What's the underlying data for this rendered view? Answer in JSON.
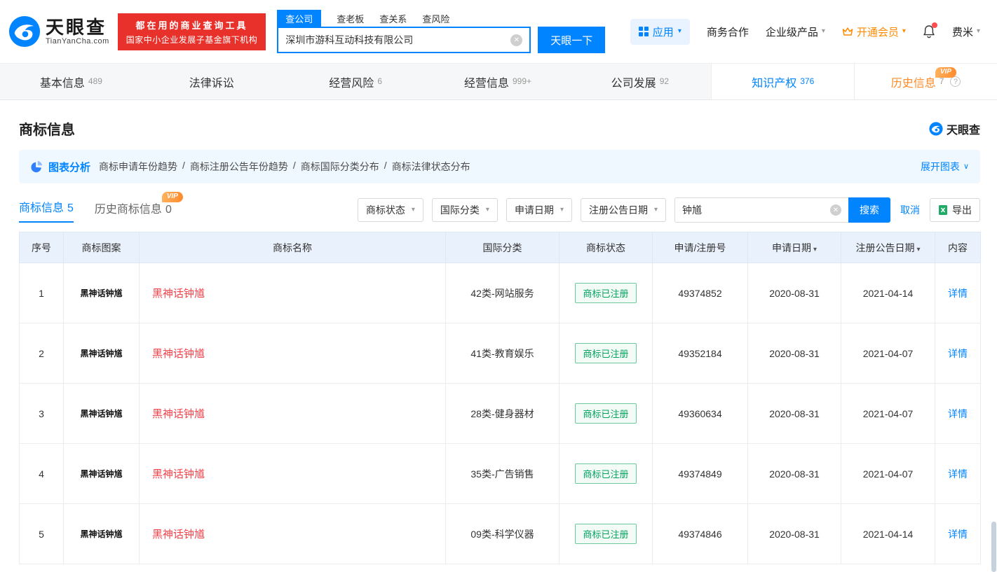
{
  "colors": {
    "brand_blue": "#0084ff",
    "slogan_red": "#e9312b",
    "vip_orange": "#ff8a00",
    "history_orange": "#ff8a26",
    "status_green": "#00a35c",
    "name_red": "#f2434b"
  },
  "icons": {
    "caret_down": "▾",
    "clear": "✕",
    "help": "?",
    "expand_caret": "∨"
  },
  "badges": {
    "vip": "VIP"
  },
  "header": {
    "logo": {
      "brand": "天眼查",
      "domain": "TianYanCha.com"
    },
    "slogan": {
      "line1": "都在用的商业查询工具",
      "line2": "国家中小企业发展子基金旗下机构"
    },
    "search_tabs": [
      {
        "label": "查公司"
      },
      {
        "label": "查老板"
      },
      {
        "label": "查关系"
      },
      {
        "label": "查风险"
      }
    ],
    "search": {
      "value": "深圳市游科互动科技有限公司",
      "button": "天眼一下"
    },
    "nav": {
      "apps": "应用",
      "cooperation": "商务合作",
      "enterprise": "企业级产品",
      "vip": "开通会员",
      "user": "费米"
    }
  },
  "tabbar": [
    {
      "label": "基本信息",
      "count": "489"
    },
    {
      "label": "法律诉讼",
      "count": ""
    },
    {
      "label": "经营风险",
      "count": "6"
    },
    {
      "label": "经营信息",
      "count": "999+"
    },
    {
      "label": "公司发展",
      "count": "92"
    },
    {
      "label": "知识产权",
      "count": "376"
    },
    {
      "label": "历史信息",
      "count": "7"
    }
  ],
  "section": {
    "title": "商标信息",
    "brand": "天眼查"
  },
  "chart_banner": {
    "label": "图表分析",
    "links": [
      "商标申请年份趋势",
      "商标注册公告年份趋势",
      "商标国际分类分布",
      "商标法律状态分布"
    ],
    "separator": "/",
    "expand": "展开图表"
  },
  "subtabs": {
    "current_label": "商标信息",
    "current_count": "5",
    "history_label": "历史商标信息",
    "history_count": "0"
  },
  "filters": {
    "status": "商标状态",
    "intl_class": "国际分类",
    "apply_date": "申请日期",
    "pub_date": "注册公告日期",
    "search_value": "钟馗",
    "search_button": "搜索",
    "cancel": "取消",
    "export": "导出"
  },
  "table": {
    "columns": [
      "序号",
      "商标图案",
      "商标名称",
      "国际分类",
      "商标状态",
      "申请/注册号",
      "申请日期",
      "注册公告日期",
      "内容"
    ],
    "rows": [
      {
        "no": "1",
        "image_text": "黑神话钟馗",
        "name": "黑神话钟馗",
        "intl_class": "42类-网站服务",
        "status": "商标已注册",
        "reg_no": "49374852",
        "apply_date": "2020-08-31",
        "pub_date": "2021-04-14",
        "action": "详情"
      },
      {
        "no": "2",
        "image_text": "黑神话钟馗",
        "name": "黑神话钟馗",
        "intl_class": "41类-教育娱乐",
        "status": "商标已注册",
        "reg_no": "49352184",
        "apply_date": "2020-08-31",
        "pub_date": "2021-04-07",
        "action": "详情"
      },
      {
        "no": "3",
        "image_text": "黑神话钟馗",
        "name": "黑神话钟馗",
        "intl_class": "28类-健身器材",
        "status": "商标已注册",
        "reg_no": "49360634",
        "apply_date": "2020-08-31",
        "pub_date": "2021-04-07",
        "action": "详情"
      },
      {
        "no": "4",
        "image_text": "黑神话钟馗",
        "name": "黑神话钟馗",
        "intl_class": "35类-广告销售",
        "status": "商标已注册",
        "reg_no": "49374849",
        "apply_date": "2020-08-31",
        "pub_date": "2021-04-07",
        "action": "详情"
      },
      {
        "no": "5",
        "image_text": "黑神话钟馗",
        "name": "黑神话钟馗",
        "intl_class": "09类-科学仪器",
        "status": "商标已注册",
        "reg_no": "49374846",
        "apply_date": "2020-08-31",
        "pub_date": "2021-04-14",
        "action": "详情"
      }
    ]
  }
}
